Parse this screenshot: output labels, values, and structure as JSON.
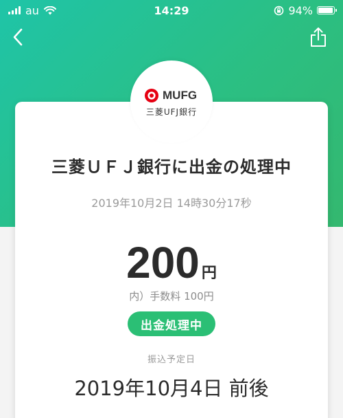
{
  "status_bar": {
    "carrier": "au",
    "time": "14:29",
    "battery": "94%",
    "battery_level": 0.94
  },
  "bank": {
    "logo_text": "MUFG",
    "name": "三菱UFJ銀行"
  },
  "transaction": {
    "title": "三菱ＵＦＪ銀行に出金の処理中",
    "datetime": "2019年10月2日 14時30分17秒",
    "amount": "200",
    "currency": "円",
    "fee": "内）手数料 100円",
    "status": "出金処理中",
    "transfer_label": "振込予定日",
    "transfer_date": "2019年10月4日 前後"
  },
  "colors": {
    "brand_green": "#2bbf75",
    "mufg_red": "#e60012"
  },
  "icons": {
    "back": "chevron-left-icon",
    "share": "share-icon"
  }
}
